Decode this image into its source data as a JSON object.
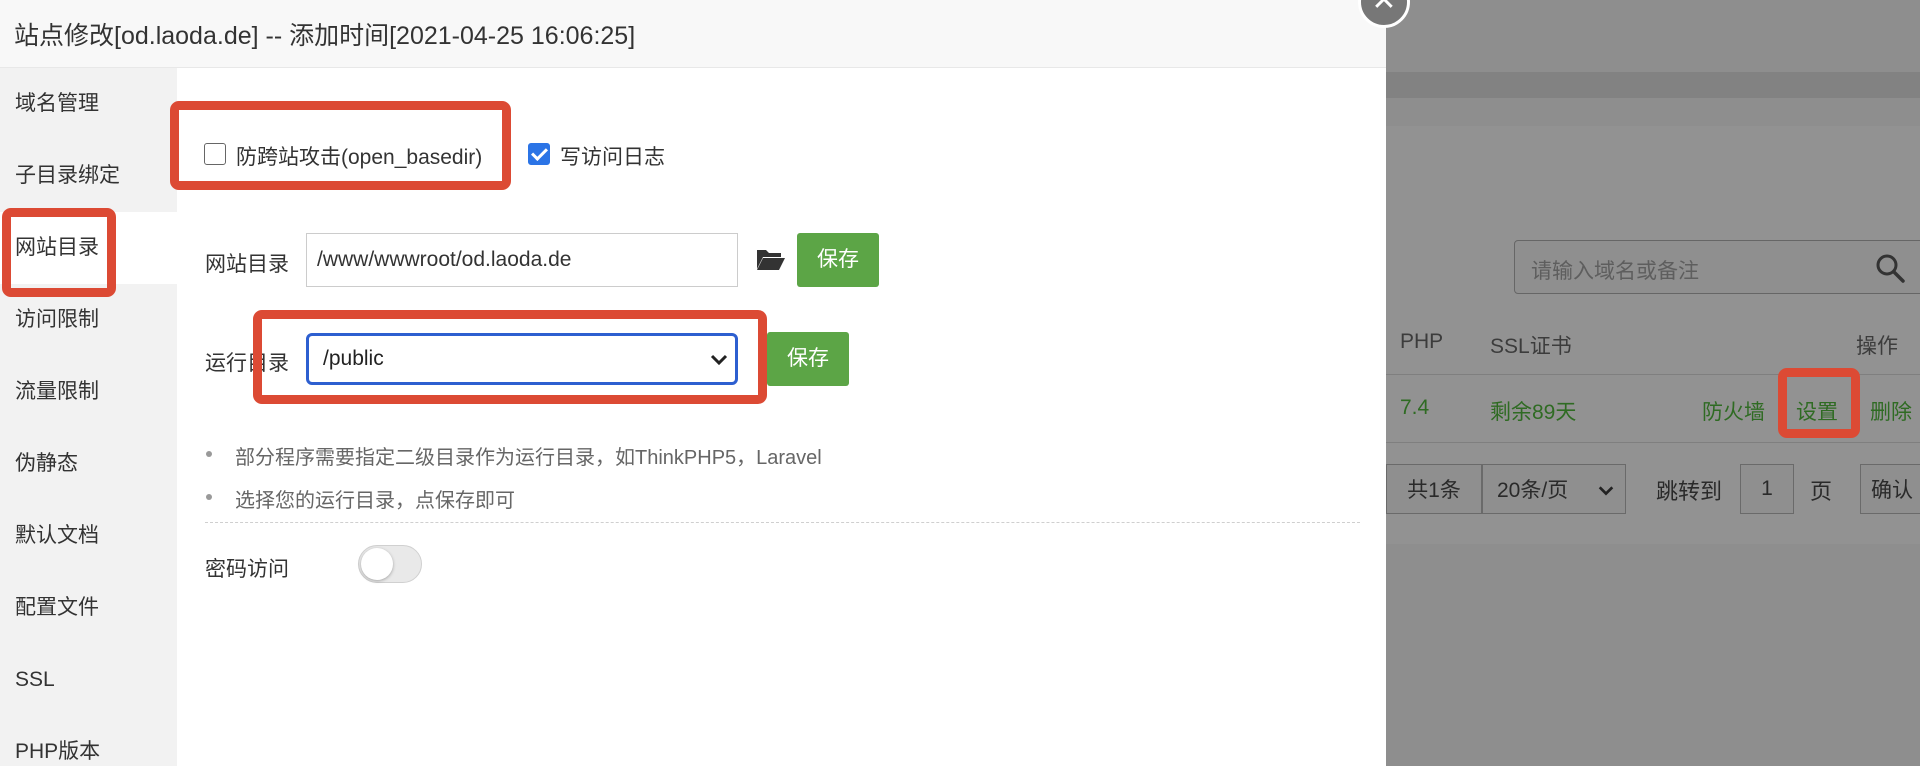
{
  "modal": {
    "title": "站点修改[od.laoda.de] -- 添加时间[2021-04-25 16:06:25]",
    "close_glyph": "✕"
  },
  "sidebar": {
    "items": [
      {
        "label": "域名管理"
      },
      {
        "label": "子目录绑定"
      },
      {
        "label": "网站目录",
        "active": true
      },
      {
        "label": "访问限制"
      },
      {
        "label": "流量限制"
      },
      {
        "label": "伪静态"
      },
      {
        "label": "默认文档"
      },
      {
        "label": "配置文件"
      },
      {
        "label": "SSL"
      },
      {
        "label": "PHP版本"
      }
    ]
  },
  "form": {
    "anti_xss_label": "防跨站攻击(open_basedir)",
    "anti_xss_checked": false,
    "access_log_label": "写访问日志",
    "access_log_checked": true,
    "site_dir_label": "网站目录",
    "site_dir_value": "/www/wwwroot/od.laoda.de",
    "run_dir_label": "运行目录",
    "run_dir_value": "/public",
    "save_label": "保存",
    "tips": [
      "部分程序需要指定二级目录作为运行目录，如ThinkPHP5，Laravel",
      "选择您的运行目录，点保存即可"
    ],
    "password_access_label": "密码访问",
    "password_access_on": false
  },
  "background": {
    "search_placeholder": "请输入域名或备注",
    "col_php": "PHP",
    "col_ssl": "SSL证书",
    "col_ops": "操作",
    "row": {
      "php": "7.4",
      "ssl": "剩余89天",
      "firewall": "防火墙",
      "settings": "设置",
      "delete": "删除"
    },
    "pager": {
      "total": "共1条",
      "per_page": "20条/页",
      "goto": "跳转到",
      "page_value": "1",
      "page_unit": "页",
      "confirm": "确认"
    }
  },
  "colors": {
    "highlight": "#dc4a34",
    "button_green": "#5ca546",
    "checkbox_blue": "#2b74e6"
  }
}
